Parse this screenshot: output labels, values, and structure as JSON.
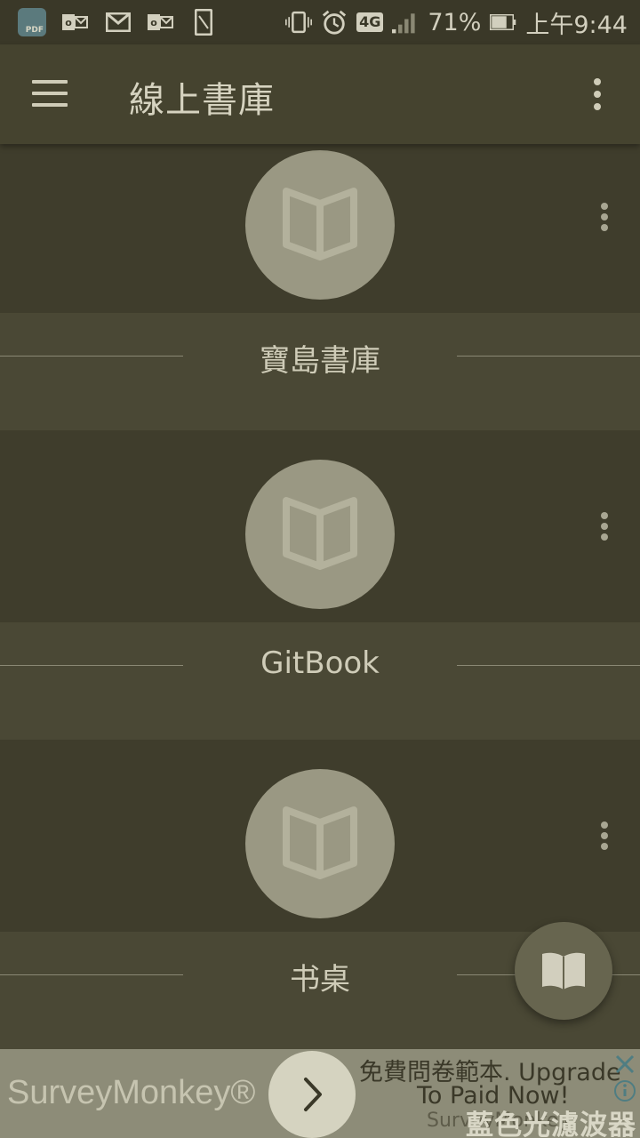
{
  "status_bar": {
    "pdf_icon_text": "PDF",
    "network_type": "4G",
    "battery": "71%",
    "time": "上午9:44"
  },
  "app_bar": {
    "title": "線上書庫"
  },
  "libraries": [
    {
      "name": "寶島書庫"
    },
    {
      "name": "GitBook"
    },
    {
      "name": "书桌"
    }
  ],
  "ad": {
    "brand": "SurveyMonkey®",
    "headline_1": "免費問卷範本. Upgrade",
    "headline_2": "To Paid Now!",
    "source": "SurveyMonkey",
    "watermark": "藍色光濾波器"
  },
  "colors": {
    "background": "#3f3d2c",
    "card_label_band": "#4a4835",
    "book_circle": "#9a9883",
    "ad_background": "#8d8c78"
  },
  "icons": {
    "menu": "hamburger-menu-icon",
    "overflow": "more-vert-icon",
    "book": "open-book-icon",
    "fab": "open-book-icon"
  }
}
